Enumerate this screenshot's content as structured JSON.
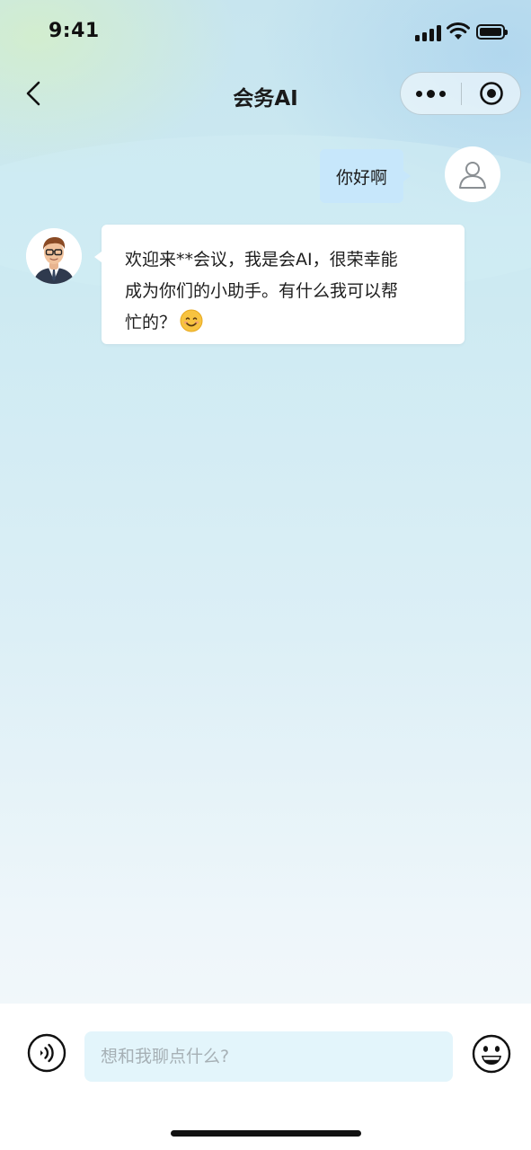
{
  "status_bar": {
    "time": "9:41"
  },
  "nav": {
    "title": "会务AI"
  },
  "messages": {
    "user": {
      "text": "你好啊"
    },
    "ai": {
      "line1": "欢迎来**会议，我是会AI，很荣幸能",
      "line2": "成为你们的小助手。有什么我可以帮",
      "line3": "忙的？",
      "emoji": "smiling-face-emoji"
    }
  },
  "input": {
    "placeholder": "想和我聊点什么?"
  },
  "icons": {
    "back": "chevron-left-icon",
    "more": "more-dots-icon",
    "close": "target-circle-icon",
    "user_avatar": "person-outline-icon",
    "voice": "voice-wave-icon",
    "emoji": "smiley-face-icon"
  },
  "colors": {
    "user_bubble": "#c7e7fb",
    "ai_bubble": "#ffffff",
    "input_bg": "#e3f5fb"
  }
}
